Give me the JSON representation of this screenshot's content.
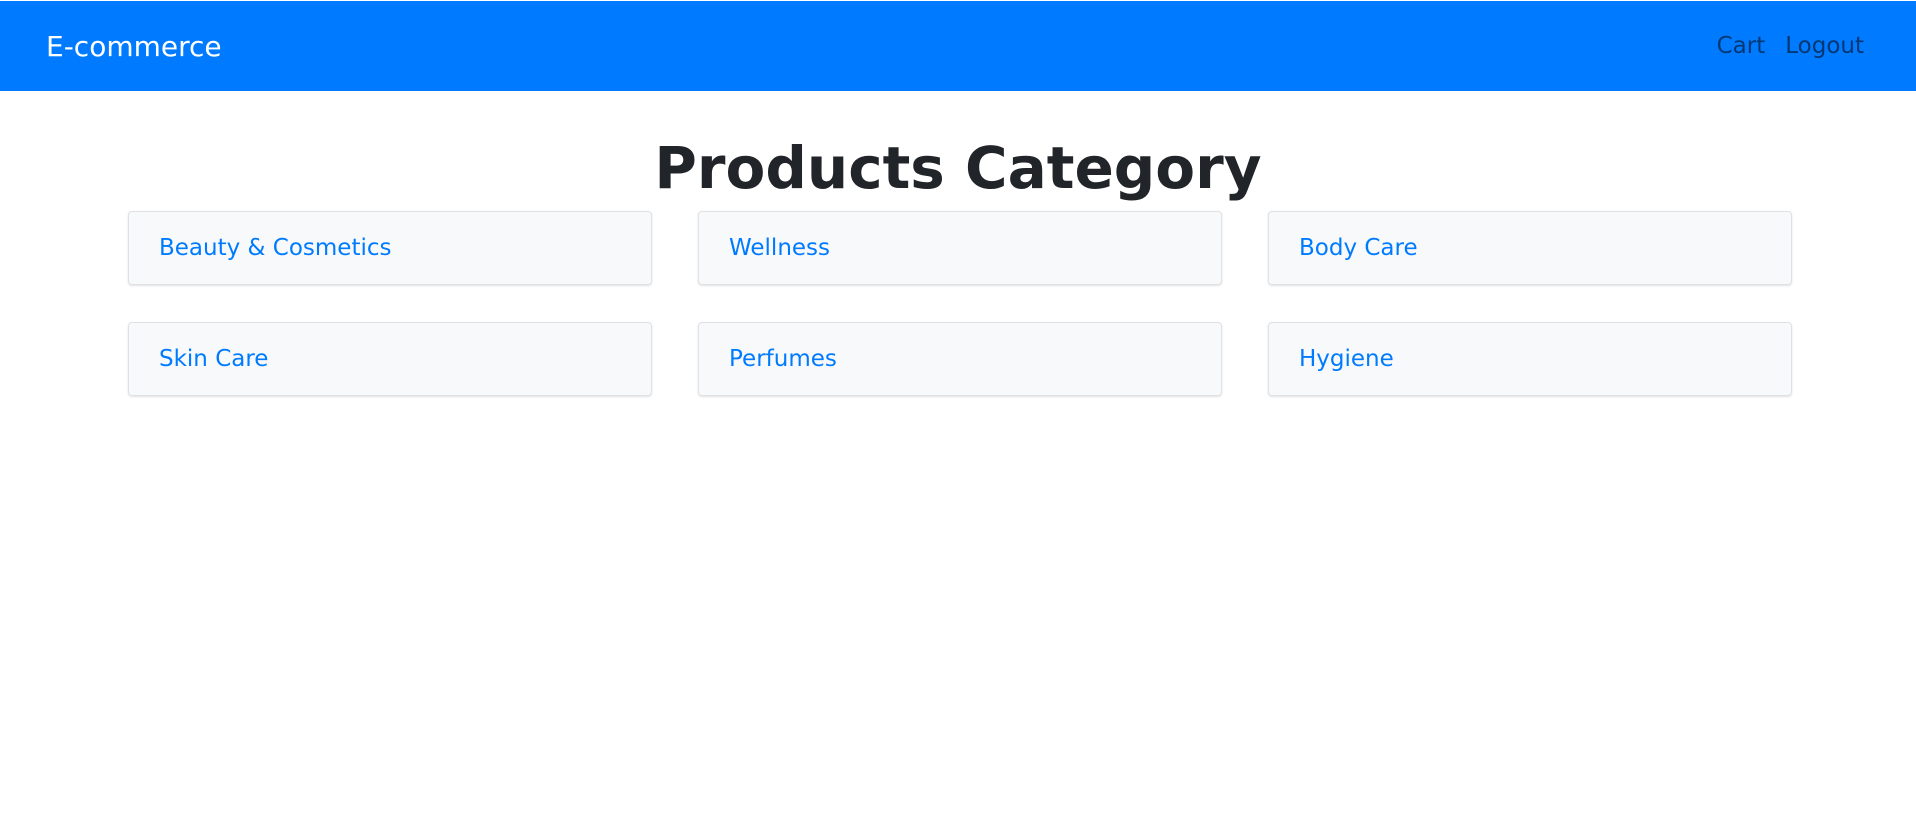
{
  "navbar": {
    "brand": "E-commerce",
    "links": [
      {
        "label": "Cart"
      },
      {
        "label": "Logout"
      }
    ],
    "color": "#007bff"
  },
  "main": {
    "title": "Products Category",
    "categories": [
      {
        "label": "Beauty & Cosmetics"
      },
      {
        "label": "Wellness"
      },
      {
        "label": "Body Care"
      },
      {
        "label": "Skin Care"
      },
      {
        "label": "Perfumes"
      },
      {
        "label": "Hygiene"
      }
    ],
    "link_color": "#007bff"
  }
}
